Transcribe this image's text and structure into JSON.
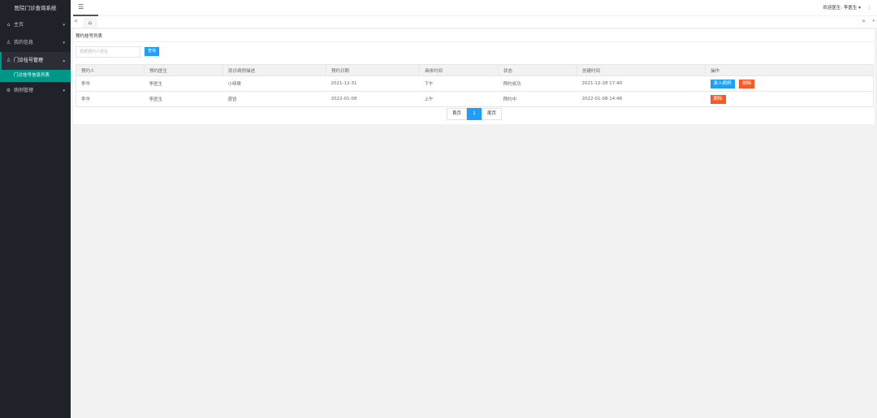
{
  "app": {
    "title": "医院门诊查询系统"
  },
  "sidebar": {
    "items": [
      {
        "label": "主页",
        "icon": "home-icon",
        "arrow": "▾"
      },
      {
        "label": "我的信息",
        "icon": "user-icon",
        "arrow": "▾"
      },
      {
        "label": "门诊挂号管理",
        "icon": "user-icon",
        "arrow": "▴"
      },
      {
        "label": "病例管理",
        "icon": "gear-icon",
        "arrow": "▾"
      }
    ],
    "subitem": {
      "label": "门诊挂号信息列表"
    }
  },
  "header": {
    "menu_icon": "☰",
    "welcome": "欢迎医生: 李医生 ▾",
    "more_icon": "⋮"
  },
  "tabs": {
    "prev_icon": "«",
    "home_icon": "⌂",
    "next_icon": "»",
    "down_icon": "▾"
  },
  "content": {
    "title": "预约挂号列表",
    "search": {
      "placeholder": "根据预约人姓名",
      "button_label": "查询"
    },
    "table": {
      "columns": [
        "预约人",
        "预约医生",
        "就诊病例描述",
        "预约日期",
        "具体时间",
        "状态",
        "创建时间",
        "操作"
      ],
      "rows": [
        {
          "cells": [
            "李华",
            "李医生",
            "小咳嗽",
            "2021-12-31",
            "下午",
            "预约成功",
            "2021-12-28 17:40"
          ],
          "actions": [
            {
              "label": "录入病例",
              "color": "#1e9fff"
            },
            {
              "label": "删除",
              "color": "#ff5722"
            }
          ]
        },
        {
          "cells": [
            "李华",
            "李医生",
            "感冒",
            "2022-01-08",
            "上午",
            "预约中",
            "2022-01-08 14:48"
          ],
          "actions": [
            {
              "label": "删除",
              "color": "#ff5722"
            }
          ]
        }
      ]
    },
    "pager": {
      "first": "首页",
      "current": "1",
      "last": "尾页"
    }
  },
  "colors": {
    "sidebar_bg": "#20222a",
    "accent": "#009688",
    "primary": "#1e9fff",
    "danger": "#ff5722"
  }
}
